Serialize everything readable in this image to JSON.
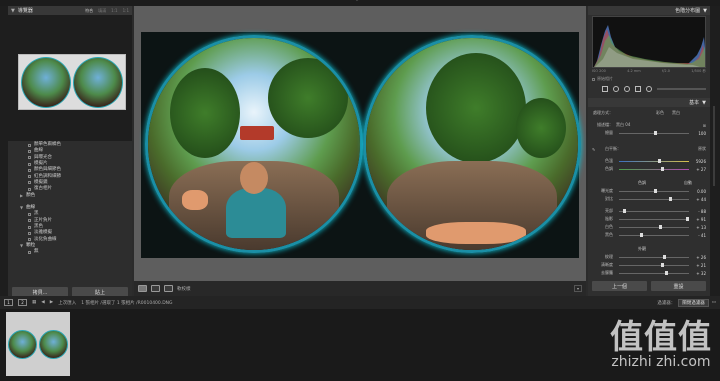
{
  "top": {
    "collapse_arrow": "⌃"
  },
  "navigator": {
    "title": "導覽器",
    "zoom": [
      "符合",
      "填滿",
      "1:1",
      "1:1"
    ]
  },
  "presets": [
    {
      "label": "顏單色兩橘色",
      "folder": false
    },
    {
      "label": "曲線",
      "folder": false
    },
    {
      "label": "與曝光合",
      "folder": false
    },
    {
      "label": "模擬片",
      "folder": false
    },
    {
      "label": "顏色與細節色",
      "folder": false
    },
    {
      "label": "紅色調和細節",
      "folder": false
    },
    {
      "label": "模擬鏡",
      "folder": false
    },
    {
      "label": "復古相片",
      "folder": false
    },
    {
      "label": "顏色",
      "folder": true
    },
    {
      "label": "",
      "folder": false
    },
    {
      "label": "曲線",
      "folder": true
    },
    {
      "label": "黑",
      "folder": false
    },
    {
      "label": "正片負片",
      "folder": false
    },
    {
      "label": "黑色",
      "folder": false
    },
    {
      "label": "淡雅模擬",
      "folder": false
    },
    {
      "label": "淡化負曲線",
      "folder": false
    },
    {
      "label": "顆粒",
      "folder": true
    },
    {
      "label": "無",
      "folder": false
    }
  ],
  "left_buttons": {
    "copy": "拷貝...",
    "paste": "貼上"
  },
  "center_toolbar": {
    "softproof": "軟校樣"
  },
  "right_panel": {
    "histogram_title": "色階分布圖",
    "hist_labels": [
      "ISO 200",
      "4.2 mm",
      "f/2.0",
      "1/500 秒"
    ],
    "original_photo": "原始相片",
    "basic_title": "基本",
    "treatment_label": "處理方式：",
    "treatment_color": "彩色",
    "treatment_bw": "黑白",
    "profile_label": "描述檔：",
    "profile_value": "黑白 04",
    "amount_label": "總量",
    "amount_value": "100",
    "wb_label": "白平衡：",
    "wb_value": "原狀",
    "temp_label": "色溫",
    "temp_value": "5926",
    "tint_label": "色調",
    "tint_value": "+ 27",
    "tone_title": "色調",
    "tone_auto": "自動",
    "exposure_label": "曝光度",
    "exposure_value": "0.00",
    "contrast_label": "對比",
    "contrast_value": "+ 44",
    "highlights_label": "亮部",
    "highlights_value": "- 88",
    "shadows_label": "陰影",
    "shadows_value": "+ 91",
    "whites_label": "白色",
    "whites_value": "+ 13",
    "blacks_label": "黑色",
    "blacks_value": "- 41",
    "presence_title": "外觀",
    "texture_label": "紋理",
    "texture_value": "+ 26",
    "clarity_label": "清晰度",
    "clarity_value": "+ 21",
    "dehaze_label": "去朦朧",
    "dehaze_value": "+ 32",
    "prev_btn": "上一個",
    "reset_btn": "重設"
  },
  "filmbar": {
    "page_a": "1",
    "page_b": "2",
    "source": "上次匯入",
    "count": "1 張相片 /選取了 1 張相片 /R0010400.DNG",
    "filter_label": "過濾器：",
    "filter_value": "關閉過濾器"
  },
  "watermark": {
    "big": "值值值",
    "small": "zhizhi zhi.com"
  },
  "colors": {
    "accent_ring": "#1a8fa6",
    "panel": "#2f2f2f",
    "center_bg": "#5e5e5e"
  }
}
